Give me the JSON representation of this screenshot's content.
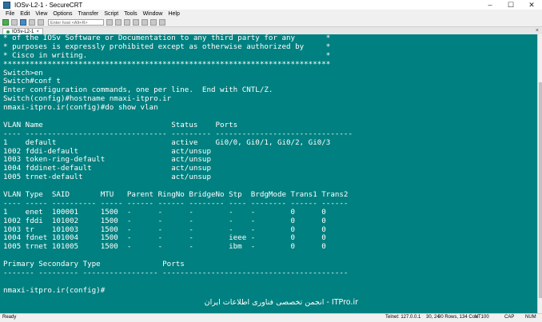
{
  "window": {
    "title": "IOSv-L2-1 - SecureCRT",
    "buttons": [
      "–",
      "☐",
      "✕"
    ]
  },
  "menu": [
    "File",
    "Edit",
    "View",
    "Options",
    "Transfer",
    "Script",
    "Tools",
    "Window",
    "Help"
  ],
  "toolbar": {
    "host_placeholder": "Enter host <Alt+R>"
  },
  "tab": {
    "label": "IOSv-L2-1",
    "close": "×"
  },
  "terminal_lines": [
    "* of the IOSv Software or Documentation to any third party for any       *",
    "* purposes is expressly prohibited except as otherwise authorized by     *",
    "* Cisco in writing.                                                      *",
    "**************************************************************************",
    "Switch>en",
    "Switch#conf t",
    "Enter configuration commands, one per line.  End with CNTL/Z.",
    "Switch(config)#hostname nmaxi-itpro.ir",
    "nmaxi-itpro.ir(config)#do show vlan",
    "",
    "VLAN Name                             Status    Ports",
    "---- -------------------------------- --------- -------------------------------",
    "1    default                          active    Gi0/0, Gi0/1, Gi0/2, Gi0/3",
    "1002 fddi-default                     act/unsup",
    "1003 token-ring-default               act/unsup",
    "1004 fddinet-default                  act/unsup",
    "1005 trnet-default                    act/unsup",
    "",
    "VLAN Type  SAID       MTU   Parent RingNo BridgeNo Stp  BrdgMode Trans1 Trans2",
    "---- ----- ---------- ----- ------ ------ -------- ---- -------- ------ ------",
    "1    enet  100001     1500  -      -      -        -    -        0      0",
    "1002 fddi  101002     1500  -      -      -        -    -        0      0",
    "1003 tr    101003     1500  -      -      -        -    -        0      0",
    "1004 fdnet 101004     1500  -      -      -        ieee -        0      0",
    "1005 trnet 101005     1500  -      -      -        ibm  -        0      0",
    "",
    "Primary Secondary Type              Ports",
    "------- --------- ----------------- ------------------------------------------",
    "",
    "nmaxi-itpro.ir(config)#",
    ""
  ],
  "watermark": "ITPro.ir - انجمن تخصصی فناوری اطلاعات ایران",
  "status": {
    "ready": "Ready",
    "connection": "Telnet: 127.0.0.1",
    "position": "30,  24",
    "rows_cols": "30 Rows, 134 Cols",
    "terminal_type": "VT100",
    "caps": "CAP",
    "num": "NUM"
  },
  "colors": {
    "terminal_bg": "#008080",
    "terminal_fg": "#ffffff"
  }
}
